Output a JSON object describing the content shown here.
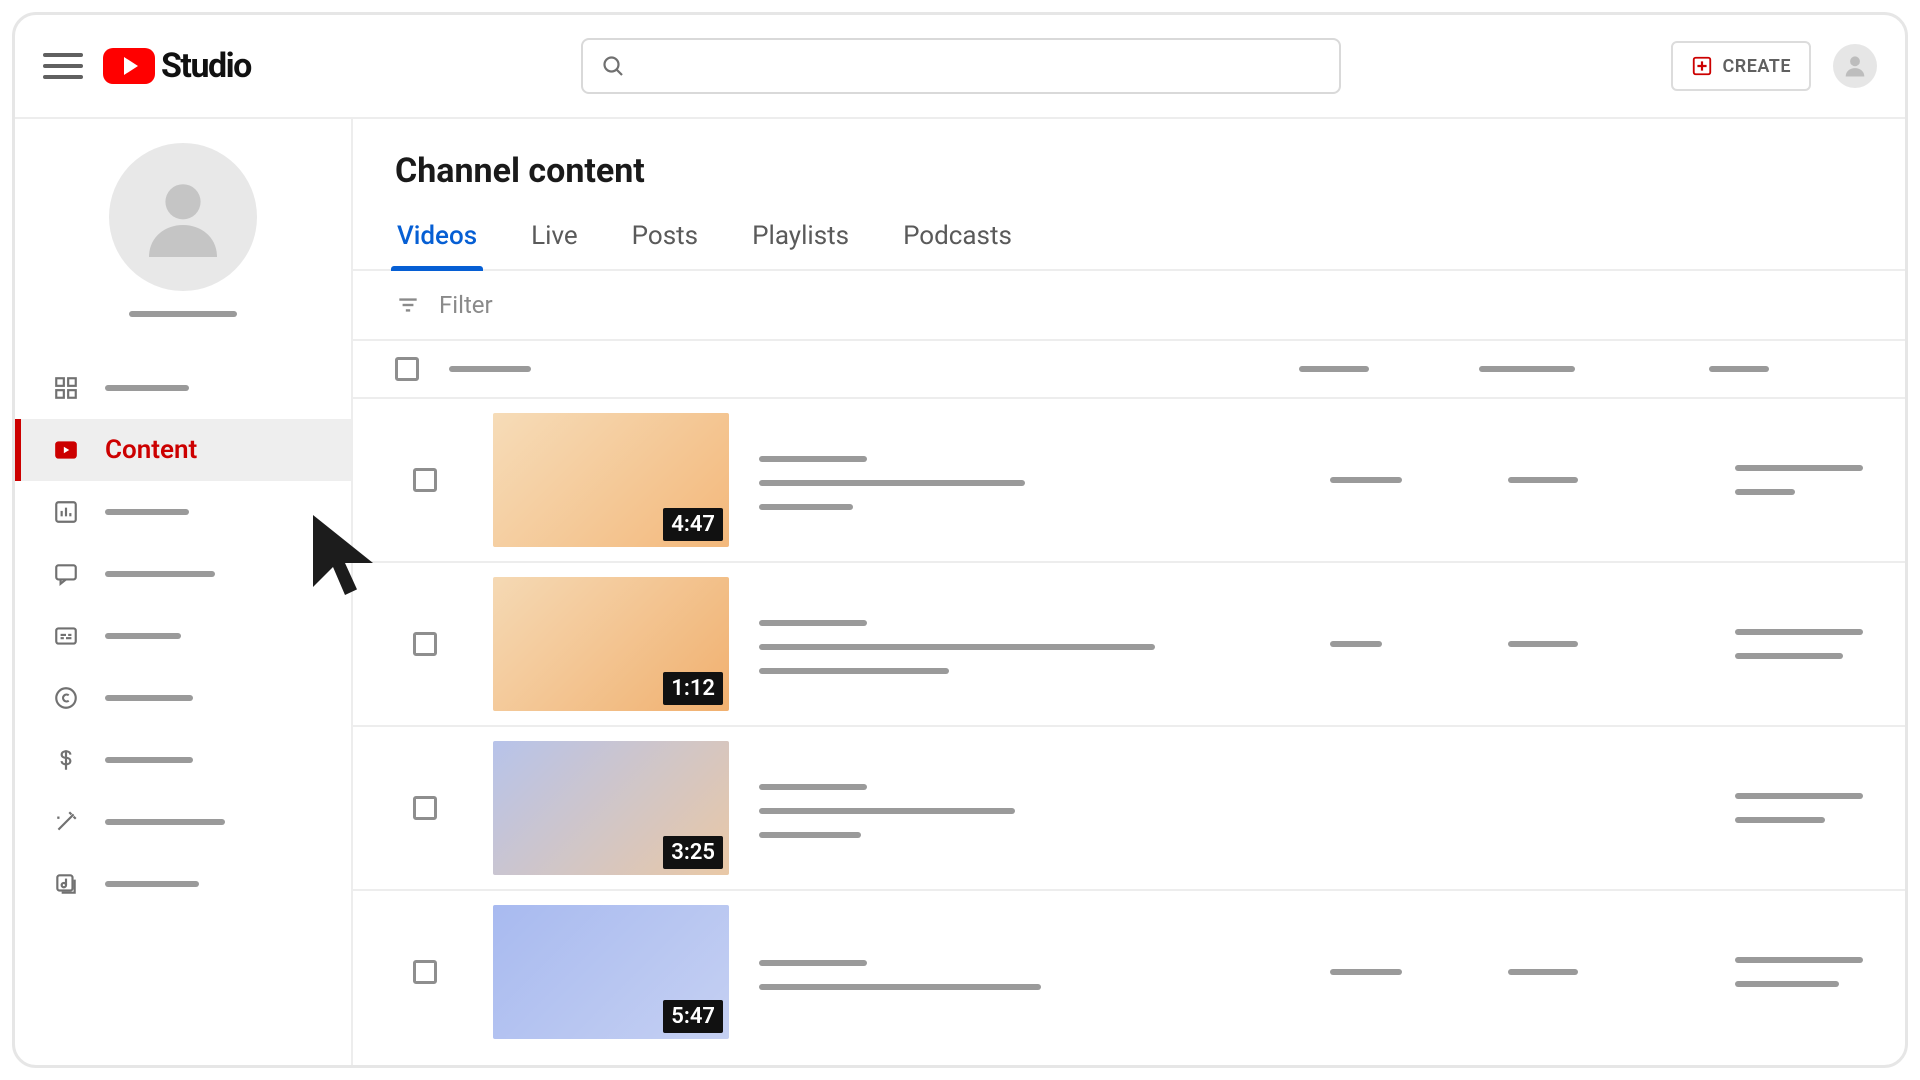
{
  "header": {
    "logo_text": "Studio",
    "search_placeholder": "",
    "create_label": "CREATE"
  },
  "sidebar": {
    "items": [
      {
        "id": "dashboard"
      },
      {
        "id": "content",
        "label": "Content",
        "active": true
      },
      {
        "id": "analytics"
      },
      {
        "id": "comments"
      },
      {
        "id": "subtitles"
      },
      {
        "id": "copyright"
      },
      {
        "id": "earn"
      },
      {
        "id": "customization"
      },
      {
        "id": "audio-library"
      }
    ]
  },
  "main": {
    "title": "Channel content",
    "tabs": [
      {
        "label": "Videos",
        "active": true
      },
      {
        "label": "Live"
      },
      {
        "label": "Posts"
      },
      {
        "label": "Playlists"
      },
      {
        "label": "Podcasts"
      }
    ],
    "filter_label": "Filter",
    "videos": [
      {
        "duration": "4:47",
        "thumb": "grad-a"
      },
      {
        "duration": "1:12",
        "thumb": "grad-b"
      },
      {
        "duration": "3:25",
        "thumb": "grad-c"
      },
      {
        "duration": "5:47",
        "thumb": "grad-d"
      }
    ]
  },
  "colors": {
    "brand_red": "#ff0000",
    "accent_blue": "#065fd4",
    "active_red": "#cc0000"
  }
}
